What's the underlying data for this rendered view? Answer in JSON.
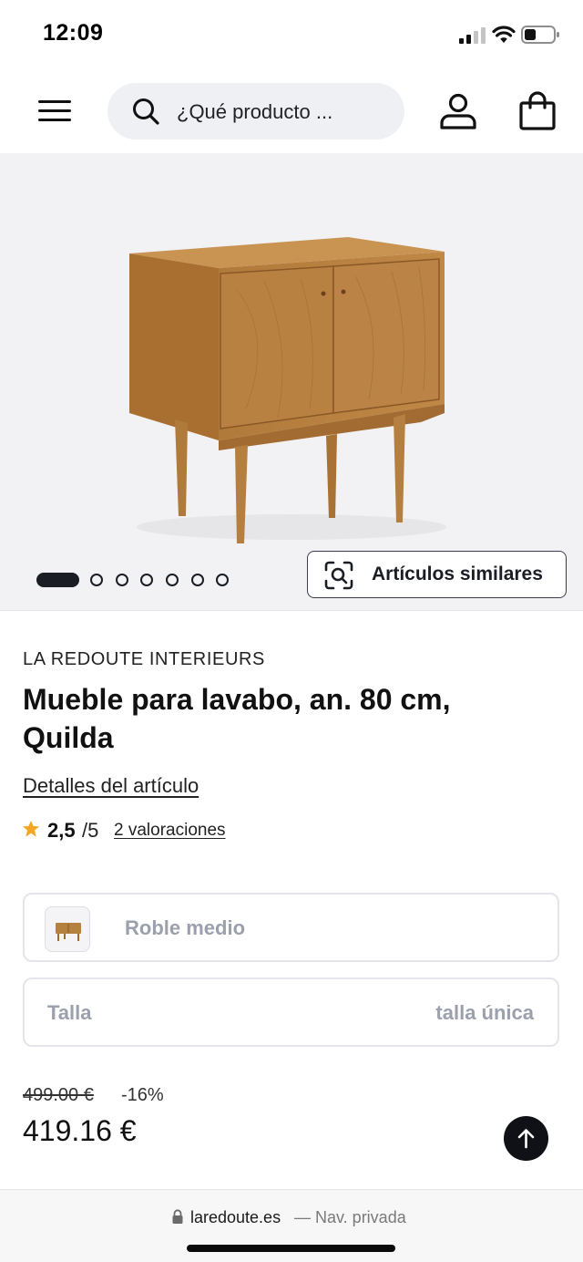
{
  "status_bar": {
    "time": "12:09"
  },
  "header": {
    "search_placeholder": "¿Qué producto ...",
    "icons": [
      "menu-icon",
      "search-icon",
      "user-icon",
      "shopping-bag-icon"
    ]
  },
  "gallery": {
    "image_count": 7,
    "active_index": 0,
    "similar_button_label": "Artículos similares"
  },
  "product": {
    "brand": "LA REDOUTE INTERIEURS",
    "title": "Mueble para lavabo, an. 80 cm, Quilda",
    "details_link": "Detalles del artículo",
    "rating": {
      "value": "2,5",
      "max": "/5",
      "reviews_label": "2 valoraciones",
      "star_color": "#f5a623"
    }
  },
  "selectors": {
    "color": {
      "label": "Roble medio"
    },
    "size": {
      "label": "Talla",
      "value": "talla única"
    }
  },
  "price": {
    "old": "499.00 €",
    "discount": "-16%",
    "current": "419.16 €"
  },
  "browser": {
    "url": "laredoute.es",
    "mode": "— Nav. privada"
  },
  "colors": {
    "accent_dark": "#1b1d24",
    "muted_text": "#9ca0ad",
    "gallery_bg": "#f2f2f4",
    "wood": "#b5813f"
  }
}
